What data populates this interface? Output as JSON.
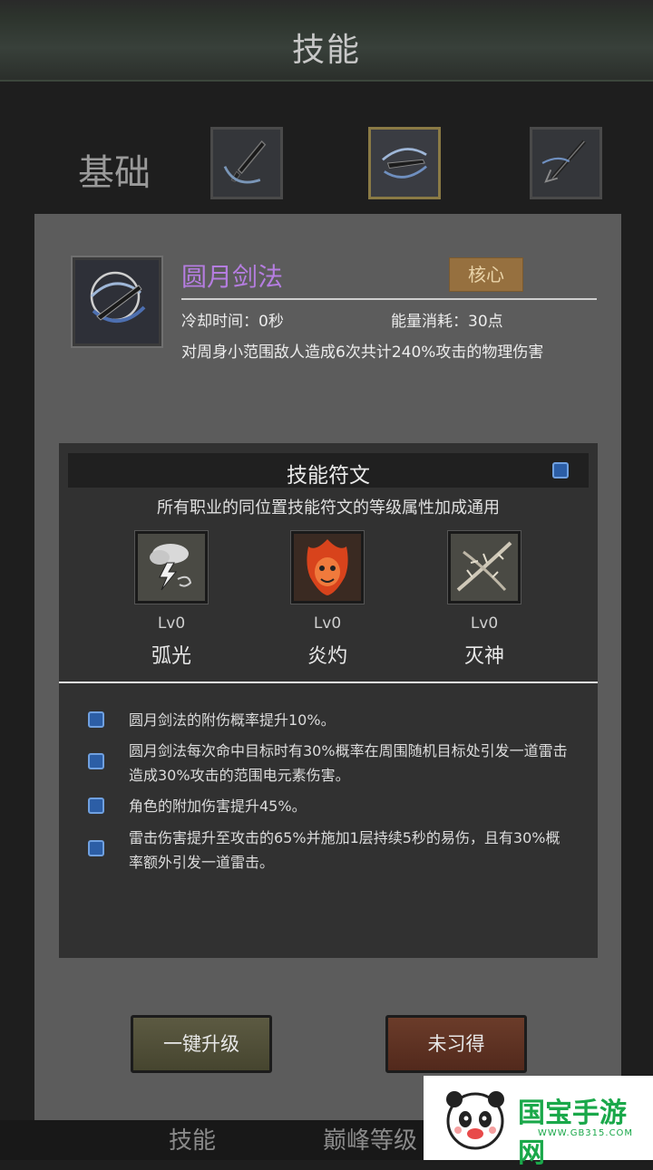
{
  "header": {
    "title": "技能"
  },
  "category": {
    "label": "基础"
  },
  "tabs": [
    {
      "icon": "dagger-slash-icon"
    },
    {
      "icon": "crescent-sword-icon",
      "active": true
    },
    {
      "icon": "trident-icon"
    }
  ],
  "skill": {
    "name": "圆月剑法",
    "badge": "核心",
    "cooldown": "冷却时间：0秒",
    "energy": "能量消耗：30点",
    "description": "对周身小范围敌人造成6次共计240%攻击的物理伤害",
    "icon": "crescent-sword-icon"
  },
  "runes": {
    "title": "技能符文",
    "subtitle": "所有职业的同位置技能符文的等级属性加成通用",
    "items": [
      {
        "level": "Lv0",
        "name": "弧光",
        "icon": "storm-cloud-icon"
      },
      {
        "level": "Lv0",
        "name": "炎灼",
        "icon": "flame-demon-icon"
      },
      {
        "level": "Lv0",
        "name": "灭神",
        "icon": "thorn-branch-icon"
      }
    ],
    "effects": [
      {
        "text": "圆月剑法的附伤概率提升10%。"
      },
      {
        "text": "圆月剑法每次命中目标时有30%概率在周围随机目标处引发一道雷击造成30%攻击的范围电元素伤害。"
      },
      {
        "text": "角色的附加伤害提升45%。"
      },
      {
        "text": "雷击伤害提升至攻击的65%并施加1层持续5秒的易伤，且有30%概率额外引发一道雷击。"
      }
    ]
  },
  "buttons": {
    "upgrade": "一键升级",
    "learn": "未习得"
  },
  "bottom_nav": {
    "item1": "技能",
    "item2": "巅峰等级"
  },
  "watermark": {
    "brand": "国宝手游网",
    "url": "WWW.GB315.COM"
  },
  "colors": {
    "skill_name": "#b57de0",
    "badge_bg": "#96703f",
    "upgrade_btn": "#4f4d36",
    "learn_btn": "#5c3020",
    "watermark_green": "#1aa84a"
  }
}
